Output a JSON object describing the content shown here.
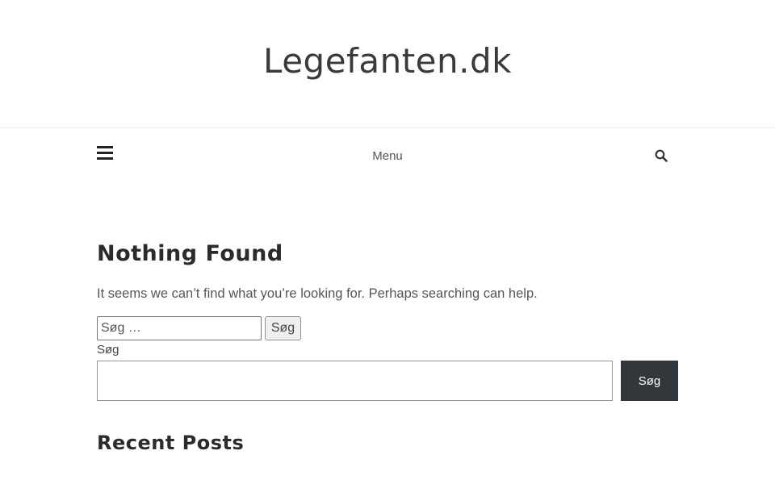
{
  "header": {
    "site_title": "Legefanten.dk"
  },
  "nav": {
    "menu_label": "Menu",
    "icons": {
      "hamburger": "hamburger-icon",
      "search": "search-icon"
    }
  },
  "main": {
    "title": "Nothing Found",
    "message": "It seems we can’t find what you’re looking for. Perhaps searching can help.",
    "classic_search": {
      "placeholder": "Søg …",
      "value": "",
      "button_label": "Søg"
    },
    "block_search": {
      "label": "Søg",
      "value": "",
      "button_label": "Søg",
      "button_color": "#32373c"
    }
  },
  "widgets": {
    "recent_posts_title": "Recent Posts"
  }
}
